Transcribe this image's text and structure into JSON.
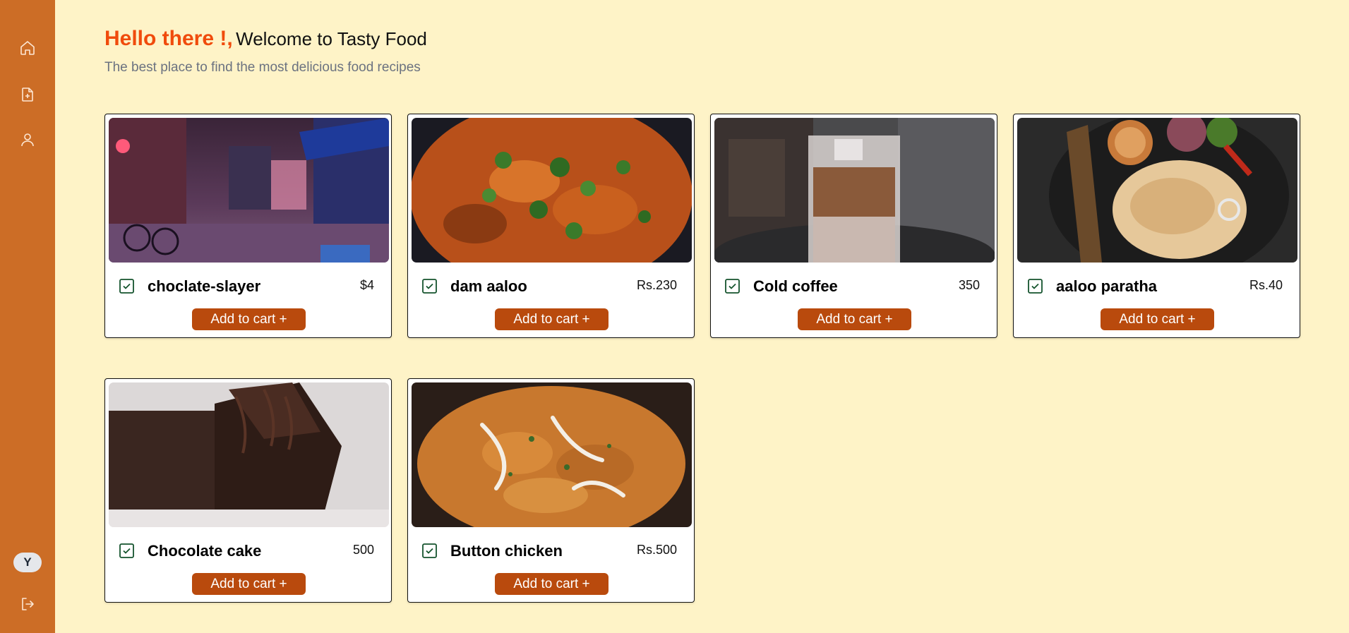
{
  "sidebar": {
    "items": [
      {
        "icon": "home-icon"
      },
      {
        "icon": "file-add-icon"
      },
      {
        "icon": "user-icon"
      }
    ],
    "avatar_initial": "Y",
    "logout_icon": "logout-icon",
    "color": "#cc6d26"
  },
  "header": {
    "greeting": "Hello there !,",
    "welcome": "Welcome to Tasty Food",
    "subtitle": "The best place to find the most delicious food recipes"
  },
  "colors": {
    "background": "#fef3c7",
    "greeting": "#f04b0c",
    "button": "#b94a0d",
    "check": "#14532d"
  },
  "cards": [
    {
      "name": "choclate-slayer",
      "price": "$4",
      "button_label": "Add to cart +",
      "image": "night street alley photo"
    },
    {
      "name": "dam aaloo",
      "price": "Rs.230",
      "button_label": "Add to cart +",
      "image": "potato curry with coriander"
    },
    {
      "name": "Cold coffee",
      "price": "350",
      "button_label": "Add to cart +",
      "image": "iced coffee glass"
    },
    {
      "name": "aaloo paratha",
      "price": "Rs.40",
      "button_label": "Add to cart +",
      "image": "paratha platter"
    },
    {
      "name": "Chocolate cake",
      "price": "500",
      "button_label": "Add to cart +",
      "image": "chocolate cake slices"
    },
    {
      "name": "Button chicken",
      "price": "Rs.500",
      "button_label": "Add to cart +",
      "image": "butter chicken curry"
    }
  ]
}
